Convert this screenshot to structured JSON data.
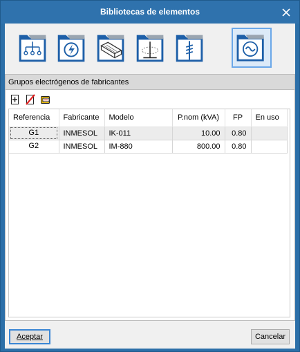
{
  "window": {
    "title": "Bibliotecas de elementos"
  },
  "toolbar": {
    "buttons": [
      {
        "name": "distribution-tree-icon",
        "selected": false
      },
      {
        "name": "lightning-icon",
        "selected": false
      },
      {
        "name": "cable-tray-icon",
        "selected": false
      },
      {
        "name": "grounding-icon",
        "selected": false
      },
      {
        "name": "surge-protector-icon",
        "selected": false
      },
      {
        "name": "generator-icon",
        "selected": true
      }
    ]
  },
  "panel": {
    "header": "Grupos electrógenos de fabricantes",
    "actions": [
      "add-icon",
      "delete-icon",
      "edit-icon"
    ]
  },
  "table": {
    "columns": [
      "Referencia",
      "Fabricante",
      "Modelo",
      "P.nom (kVA)",
      "FP",
      "En uso"
    ],
    "rows": [
      {
        "ref": "G1",
        "fabricante": "INMESOL",
        "modelo": "IK-011",
        "pnom": "10.00",
        "fp": "0.80",
        "en_uso": ""
      },
      {
        "ref": "G2",
        "fabricante": "INMESOL",
        "modelo": "IM-880",
        "pnom": "800.00",
        "fp": "0.80",
        "en_uso": ""
      }
    ],
    "selected_row": 0
  },
  "footer": {
    "ok_label": "Aceptar",
    "cancel_label": "Cancelar"
  },
  "colors": {
    "titlebar": "#2f72ad",
    "selected_border": "#6aa7e8",
    "folder_blue": "#1d5fa8"
  }
}
